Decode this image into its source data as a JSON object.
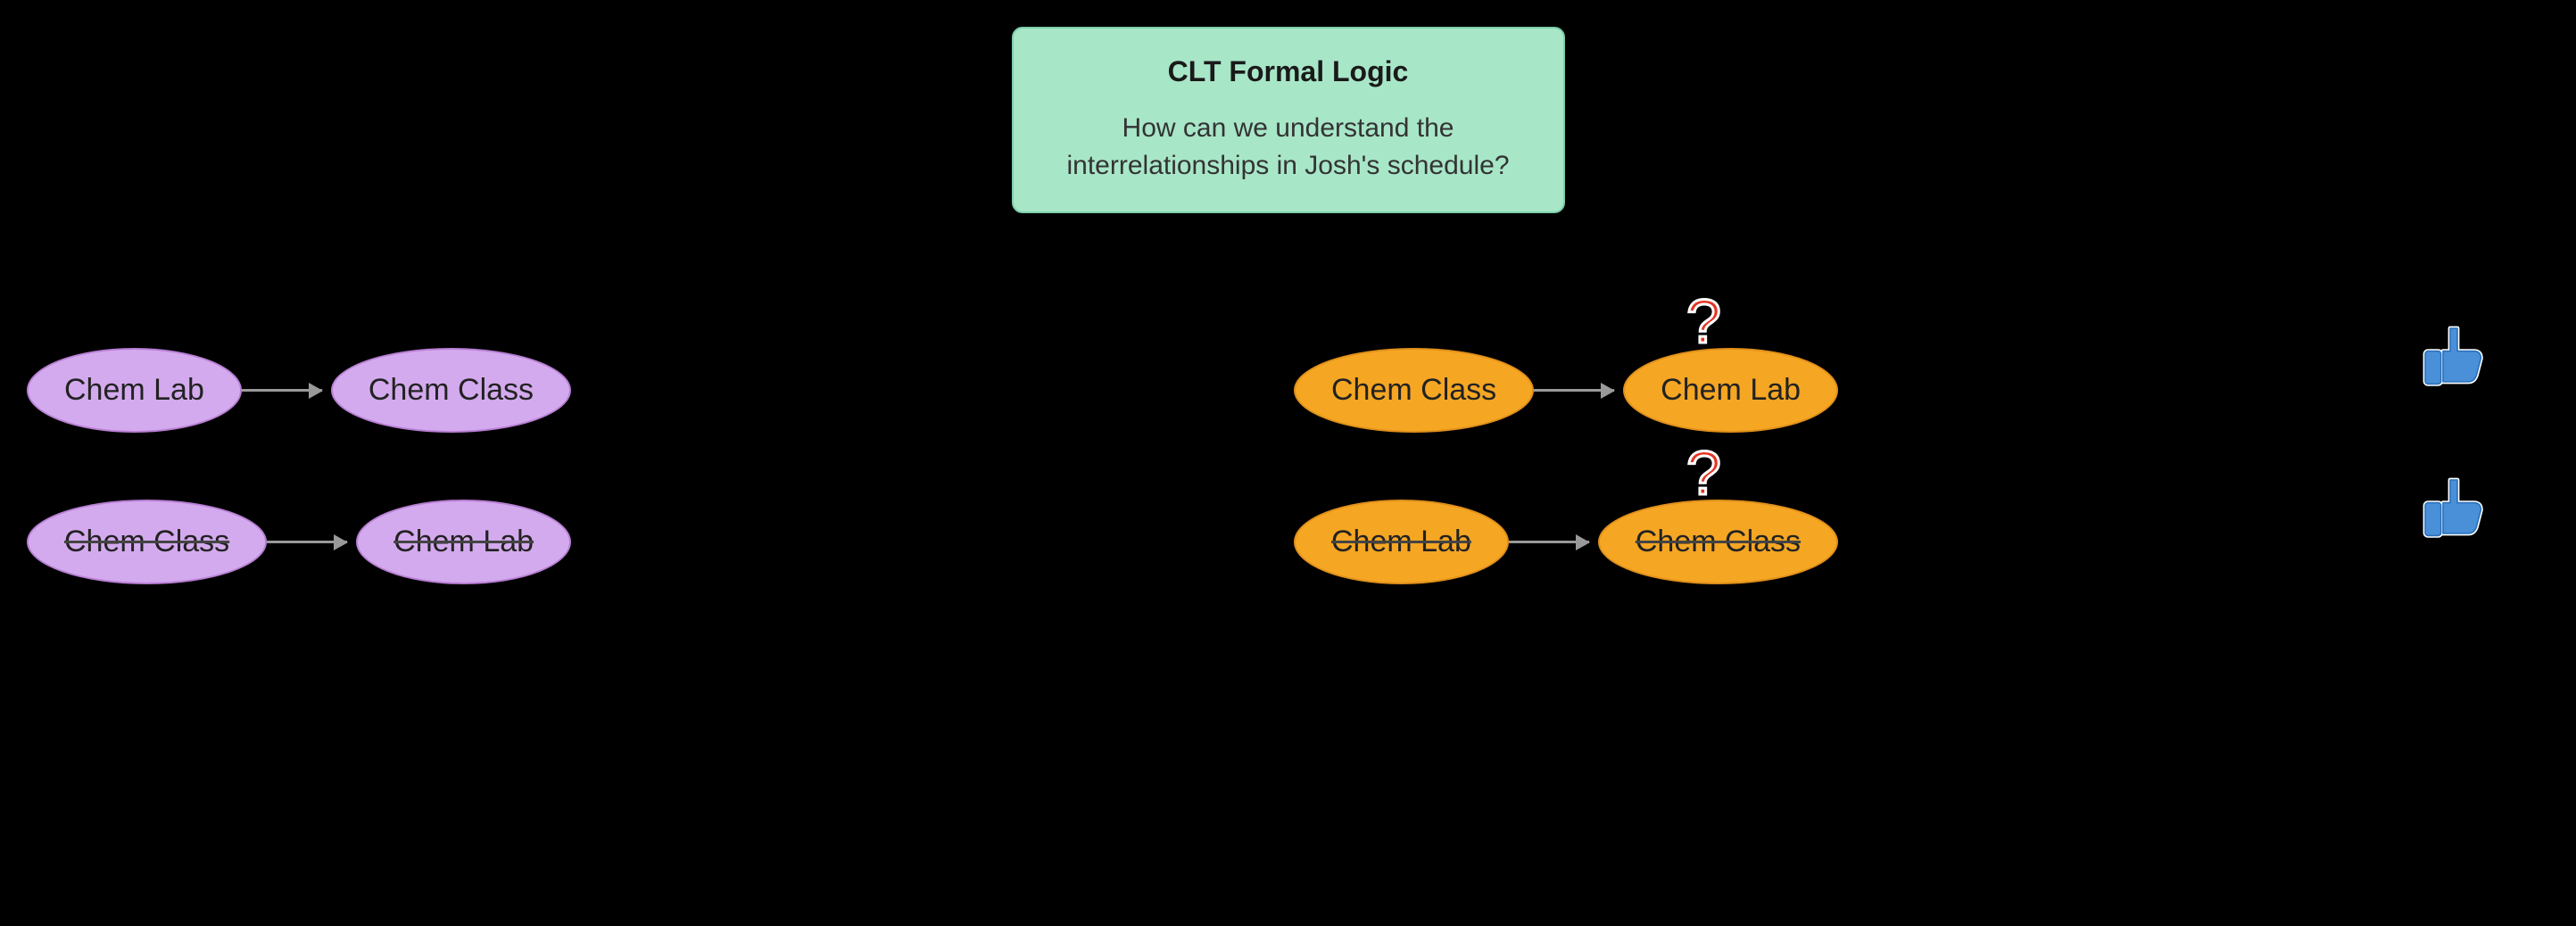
{
  "background": "#000000",
  "titleBox": {
    "title": "CLT Formal Logic",
    "subtitle": "How can we understand the\ninterrelationships in Josh's schedule?"
  },
  "leftSection": {
    "row1": {
      "node1": {
        "label": "Chem Lab",
        "style": "purple",
        "strikethrough": false
      },
      "node2": {
        "label": "Chem Class",
        "style": "purple",
        "strikethrough": false
      }
    },
    "row2": {
      "node1": {
        "label": "Chem Class",
        "style": "purple",
        "strikethrough": true
      },
      "node2": {
        "label": "Chem Lab",
        "style": "purple",
        "strikethrough": true
      }
    }
  },
  "rightSection": {
    "row1": {
      "node1": {
        "label": "Chem Class",
        "style": "orange",
        "strikethrough": false
      },
      "node2": {
        "label": "Chem Lab",
        "style": "orange",
        "strikethrough": false
      },
      "hasQuestion": true,
      "hasThumbsDown": true
    },
    "row2": {
      "node1": {
        "label": "Chem Lab",
        "style": "orange",
        "strikethrough": true
      },
      "node2": {
        "label": "Chem Class",
        "style": "orange",
        "strikethrough": true
      },
      "hasQuestion": true,
      "hasThumbsDown": true
    }
  }
}
